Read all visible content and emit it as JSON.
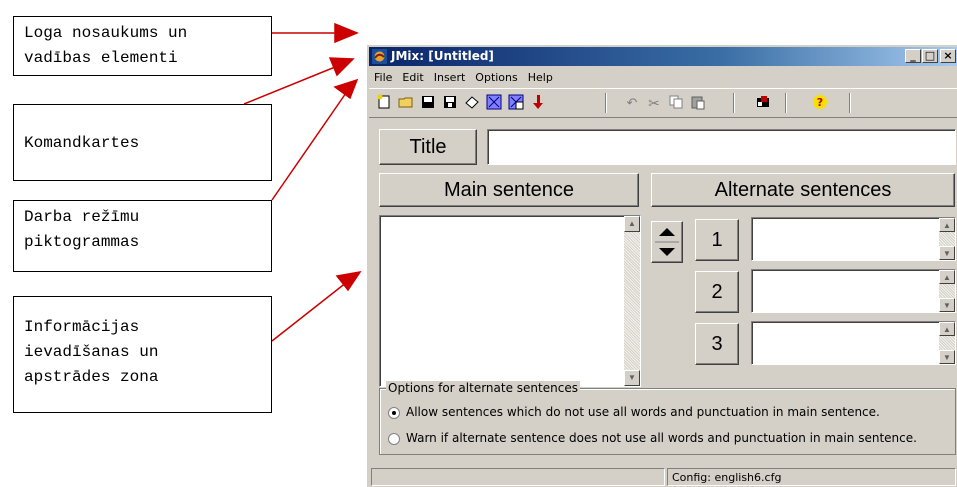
{
  "annotations": {
    "window_title_controls": "Loga nosaukums un\nvadības elementi",
    "menus": "Komandkartes",
    "mode_icons": "Darba režīmu\npiktogrammas",
    "input_area": "Informācijas\nievadīšanas un\napstrādes zona"
  },
  "window": {
    "title": "JMix: [Untitled]",
    "minimize": "_",
    "maximize": "□",
    "close": "×"
  },
  "menu": [
    "File",
    "Edit",
    "Insert",
    "Options",
    "Help"
  ],
  "toolbar_icons": [
    "new-icon",
    "open-icon",
    "save-icon",
    "save-as-icon",
    "eraser-icon",
    "web-export-icon",
    "web-export-2-icon",
    "arrow-down-icon",
    "undo-icon",
    "cut-icon",
    "copy-icon",
    "paste-icon",
    "config-icon",
    "help-icon"
  ],
  "form": {
    "title_label": "Title",
    "title_value": "",
    "main_header": "Main sentence",
    "alt_header": "Alternate sentences",
    "alt_numbers": [
      "1",
      "2",
      "3"
    ]
  },
  "options": {
    "legend": "Options for alternate sentences",
    "radio1": "Allow sentences which do not use all words and punctuation in main sentence.",
    "radio2": "Warn if alternate sentence does not use all words and punctuation in main sentence.",
    "selected": 1
  },
  "status": {
    "left": "",
    "config": "Config: english6.cfg"
  }
}
